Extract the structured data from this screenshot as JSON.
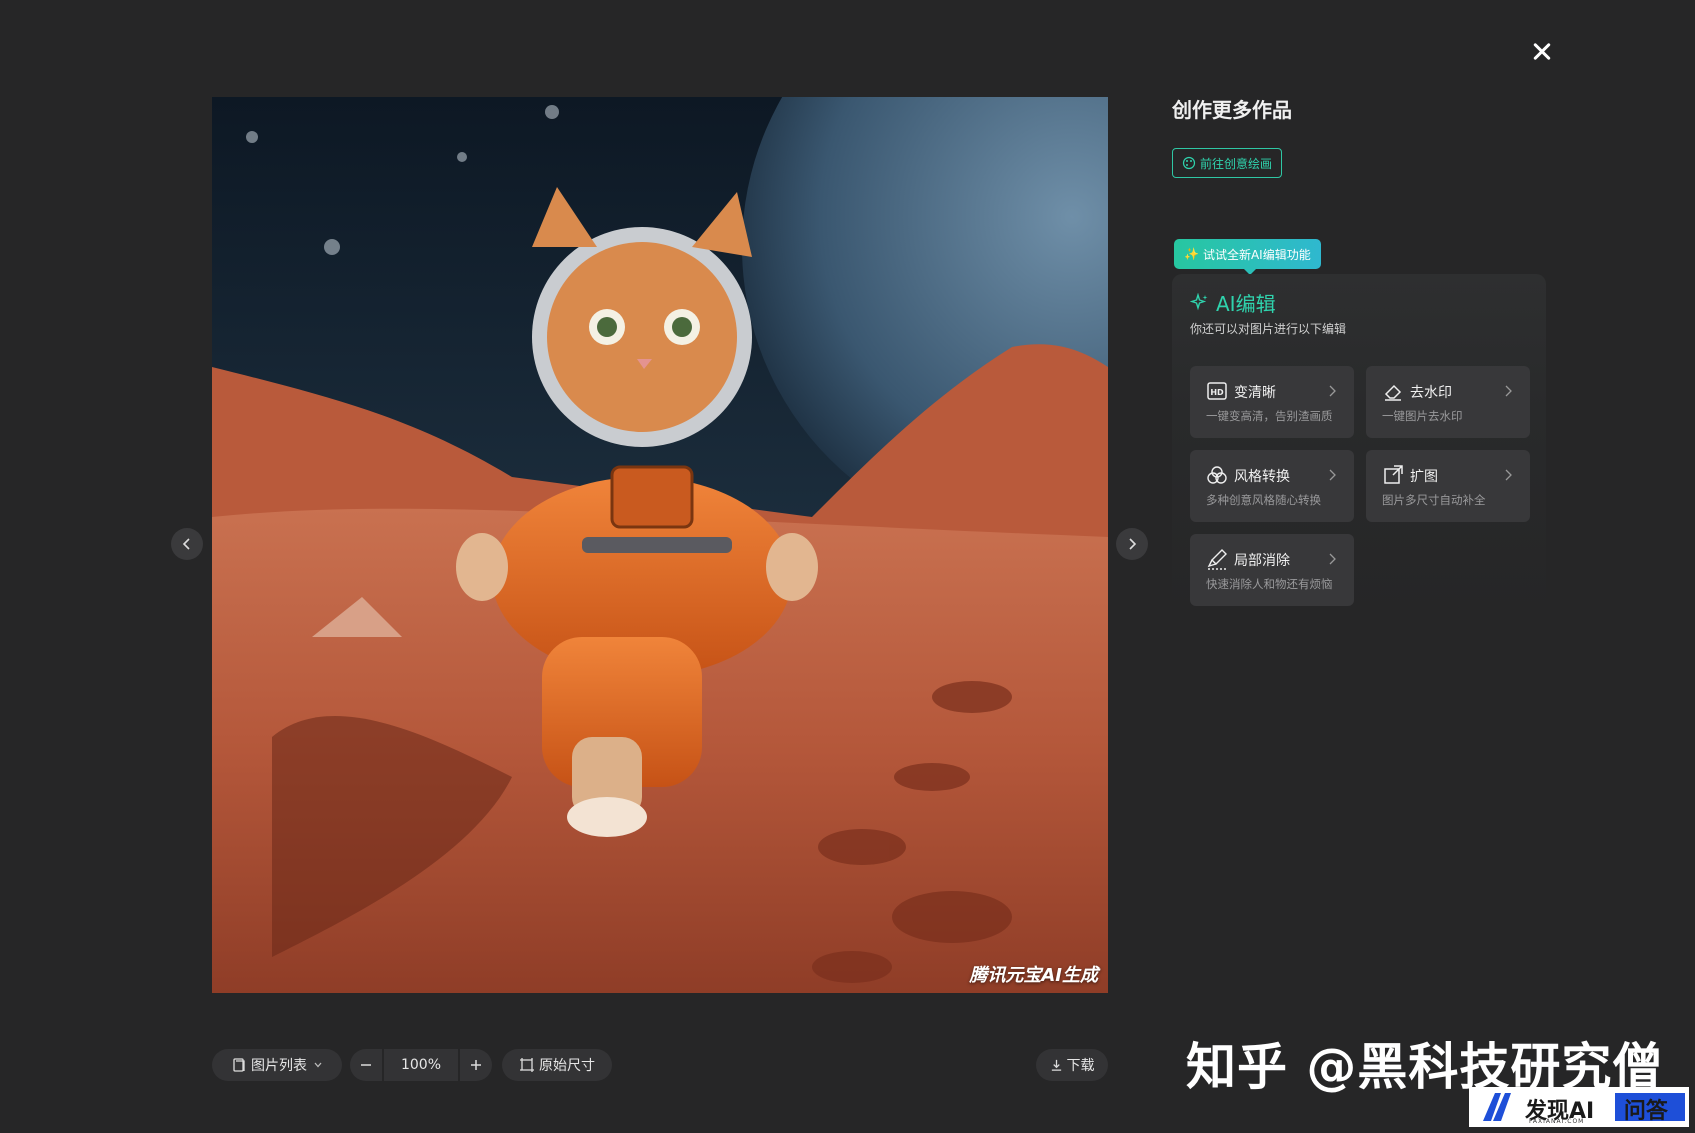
{
  "viewer": {
    "close_icon": "close-icon",
    "image_alt": "Orange kitten in an astronaut suit walking on a red planet",
    "image_watermark": "腾讯元宝AI生成",
    "prev_icon": "chevron-left-icon",
    "next_icon": "chevron-right-icon"
  },
  "toolbar": {
    "image_list_label": "图片列表",
    "zoom_value": "100%",
    "original_size_label": "原始尺寸",
    "download_label": "下载"
  },
  "panel": {
    "title": "创作更多作品",
    "go_creative_label": "前往创意绘画",
    "badge_label": "试试全新AI编辑功能",
    "ai_title": "AI编辑",
    "ai_subtitle": "你还可以对图片进行以下编辑",
    "tools": [
      {
        "label": "变清晰",
        "desc": "一键变高清，告别渣画质",
        "icon": "hd-icon"
      },
      {
        "label": "去水印",
        "desc": "一键图片去水印",
        "icon": "eraser-icon"
      },
      {
        "label": "风格转换",
        "desc": "多种创意风格随心转换",
        "icon": "style-icon"
      },
      {
        "label": "扩图",
        "desc": "图片多尺寸自动补全",
        "icon": "expand-icon"
      },
      {
        "label": "局部消除",
        "desc": "快速消除人和物还有烦恼",
        "icon": "brush-icon"
      }
    ]
  },
  "overlay": {
    "brand_text": "知乎 @黑科技研究僧",
    "badge_text": "发现AI 问答",
    "badge_sub": "FAXIANAI.COM"
  },
  "colors": {
    "accent": "#2fd3ad",
    "background": "#262627",
    "card": "#38383a"
  }
}
